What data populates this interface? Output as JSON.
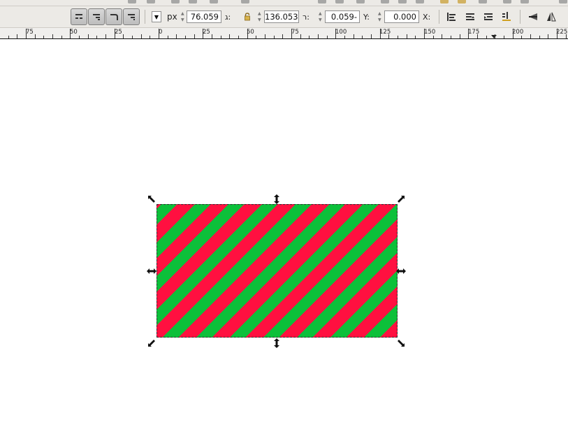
{
  "toolbar": {
    "mode_buttons": [
      {
        "icon": "scale-stroke-icon",
        "active": true
      },
      {
        "icon": "scale-corners-icon",
        "active": true
      },
      {
        "icon": "move-gradients-icon",
        "active": true
      },
      {
        "icon": "move-patterns-icon",
        "active": true
      }
    ],
    "unit": "px",
    "fields": {
      "h": {
        "value": "76.059",
        "label": "ג:"
      },
      "w": {
        "value": "136.053",
        "label": "ר:"
      },
      "y": {
        "value": "0.059-",
        "label": "Y:"
      },
      "x": {
        "value": "0.000",
        "label": "X:"
      }
    },
    "right_icons": [
      "raise-to-top-icon",
      "raise-icon",
      "lower-icon",
      "lower-to-bottom-icon",
      "rotate-icon",
      "flip-horizontal-icon"
    ]
  },
  "ruler": {
    "labels": [
      "75",
      "50",
      "25",
      "0",
      "25",
      "50",
      "75",
      "100",
      "125",
      "150",
      "175",
      "200",
      "225"
    ]
  },
  "canvas": {
    "object": {
      "type": "rectangle",
      "pattern": "diagonal-stripes",
      "colors": {
        "stripe_a": "#ff1040",
        "stripe_b": "#0cc03a"
      },
      "selected": true
    }
  }
}
